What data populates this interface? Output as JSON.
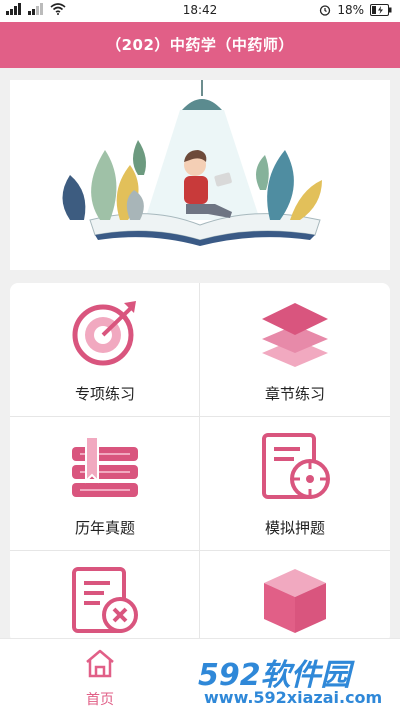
{
  "status_bar": {
    "time": "18:42",
    "battery": "18%"
  },
  "header": {
    "title": "（202）中药学（中药师）"
  },
  "menu": {
    "items": [
      {
        "label": "专项练习",
        "icon": "target-icon"
      },
      {
        "label": "章节练习",
        "icon": "layers-icon"
      },
      {
        "label": "历年真题",
        "icon": "books-icon"
      },
      {
        "label": "模拟押题",
        "icon": "document-target-icon"
      },
      {
        "label": "",
        "icon": "document-error-icon"
      },
      {
        "label": "",
        "icon": "cube-icon"
      }
    ]
  },
  "tabbar": {
    "home_label": "首页"
  },
  "watermark": {
    "logo": "592软件园",
    "url": "www.592xiazai.com"
  },
  "colors": {
    "accent": "#e15f87",
    "accent_light": "#f1a9c0"
  }
}
